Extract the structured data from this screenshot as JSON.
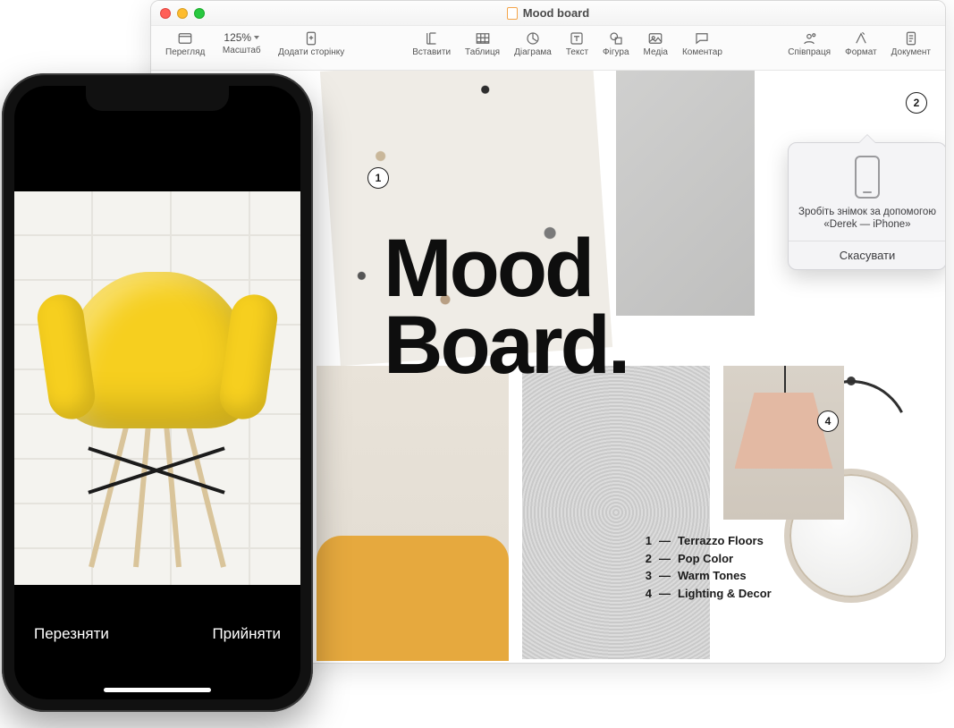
{
  "window": {
    "title": "Mood board",
    "toolbar": {
      "view": "Перегляд",
      "zoom": "Масштаб",
      "zoom_value": "125%",
      "add_page": "Додати сторінку",
      "insert": "Вставити",
      "table": "Таблиця",
      "chart": "Діаграма",
      "text": "Текст",
      "shape": "Фігура",
      "media": "Медіа",
      "comment": "Коментар",
      "collaborate": "Співпраця",
      "format": "Формат",
      "document": "Документ"
    }
  },
  "canvas": {
    "headline_line1": "Mood",
    "headline_line2": "Board.",
    "markers": {
      "m1": "1",
      "m2": "2",
      "m4": "4"
    },
    "legend": [
      {
        "num": "1",
        "label": "Terrazzo Floors"
      },
      {
        "num": "2",
        "label": "Pop Color"
      },
      {
        "num": "3",
        "label": "Warm Tones"
      },
      {
        "num": "4",
        "label": "Lighting & Decor"
      }
    ]
  },
  "popover": {
    "line1": "Зробіть знімок за допомогою",
    "line2": "«Derek — iPhone»",
    "cancel": "Скасувати"
  },
  "iphone": {
    "retake": "Перезняти",
    "use": "Прийняти"
  }
}
